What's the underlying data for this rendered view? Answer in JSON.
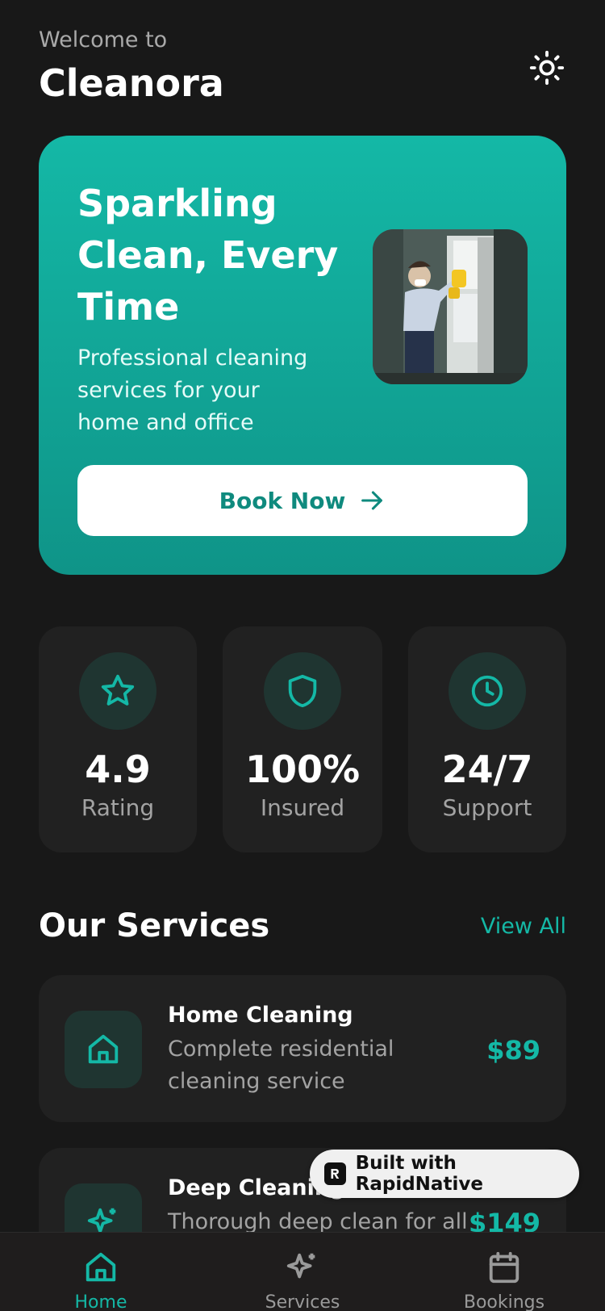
{
  "header": {
    "welcome": "Welcome to",
    "brand": "Cleanora",
    "theme_icon": "sun-icon"
  },
  "hero": {
    "title": "Sparkling Clean, Every Time",
    "subtitle": "Professional cleaning services for your home and office",
    "image_alt": "cleaner-washing-window",
    "cta_label": "Book Now",
    "cta_icon": "arrow-right-icon",
    "colors": {
      "start": "#14b8a6",
      "end": "#0f9488"
    }
  },
  "stats": [
    {
      "icon": "star-icon",
      "value": "4.9",
      "label": "Rating"
    },
    {
      "icon": "shield-icon",
      "value": "100%",
      "label": "Insured"
    },
    {
      "icon": "clock-icon",
      "value": "24/7",
      "label": "Support"
    }
  ],
  "services": {
    "title": "Our Services",
    "view_all": "View All",
    "items": [
      {
        "icon": "home-icon",
        "name": "Home Cleaning",
        "description": "Complete residential cleaning service",
        "price": "$89"
      },
      {
        "icon": "sparkle-icon",
        "name": "Deep Cleaning",
        "description": "Thorough deep clean for all",
        "price": "$149"
      }
    ]
  },
  "badge": {
    "label": "Built with RapidNative"
  },
  "tabs": [
    {
      "icon": "home-icon",
      "label": "Home",
      "active": true
    },
    {
      "icon": "sparkle-icon",
      "label": "Services",
      "active": false
    },
    {
      "icon": "calendar-icon",
      "label": "Bookings",
      "active": false
    }
  ],
  "colors": {
    "accent": "#14b8a6",
    "background": "#181818",
    "card": "#212121"
  }
}
